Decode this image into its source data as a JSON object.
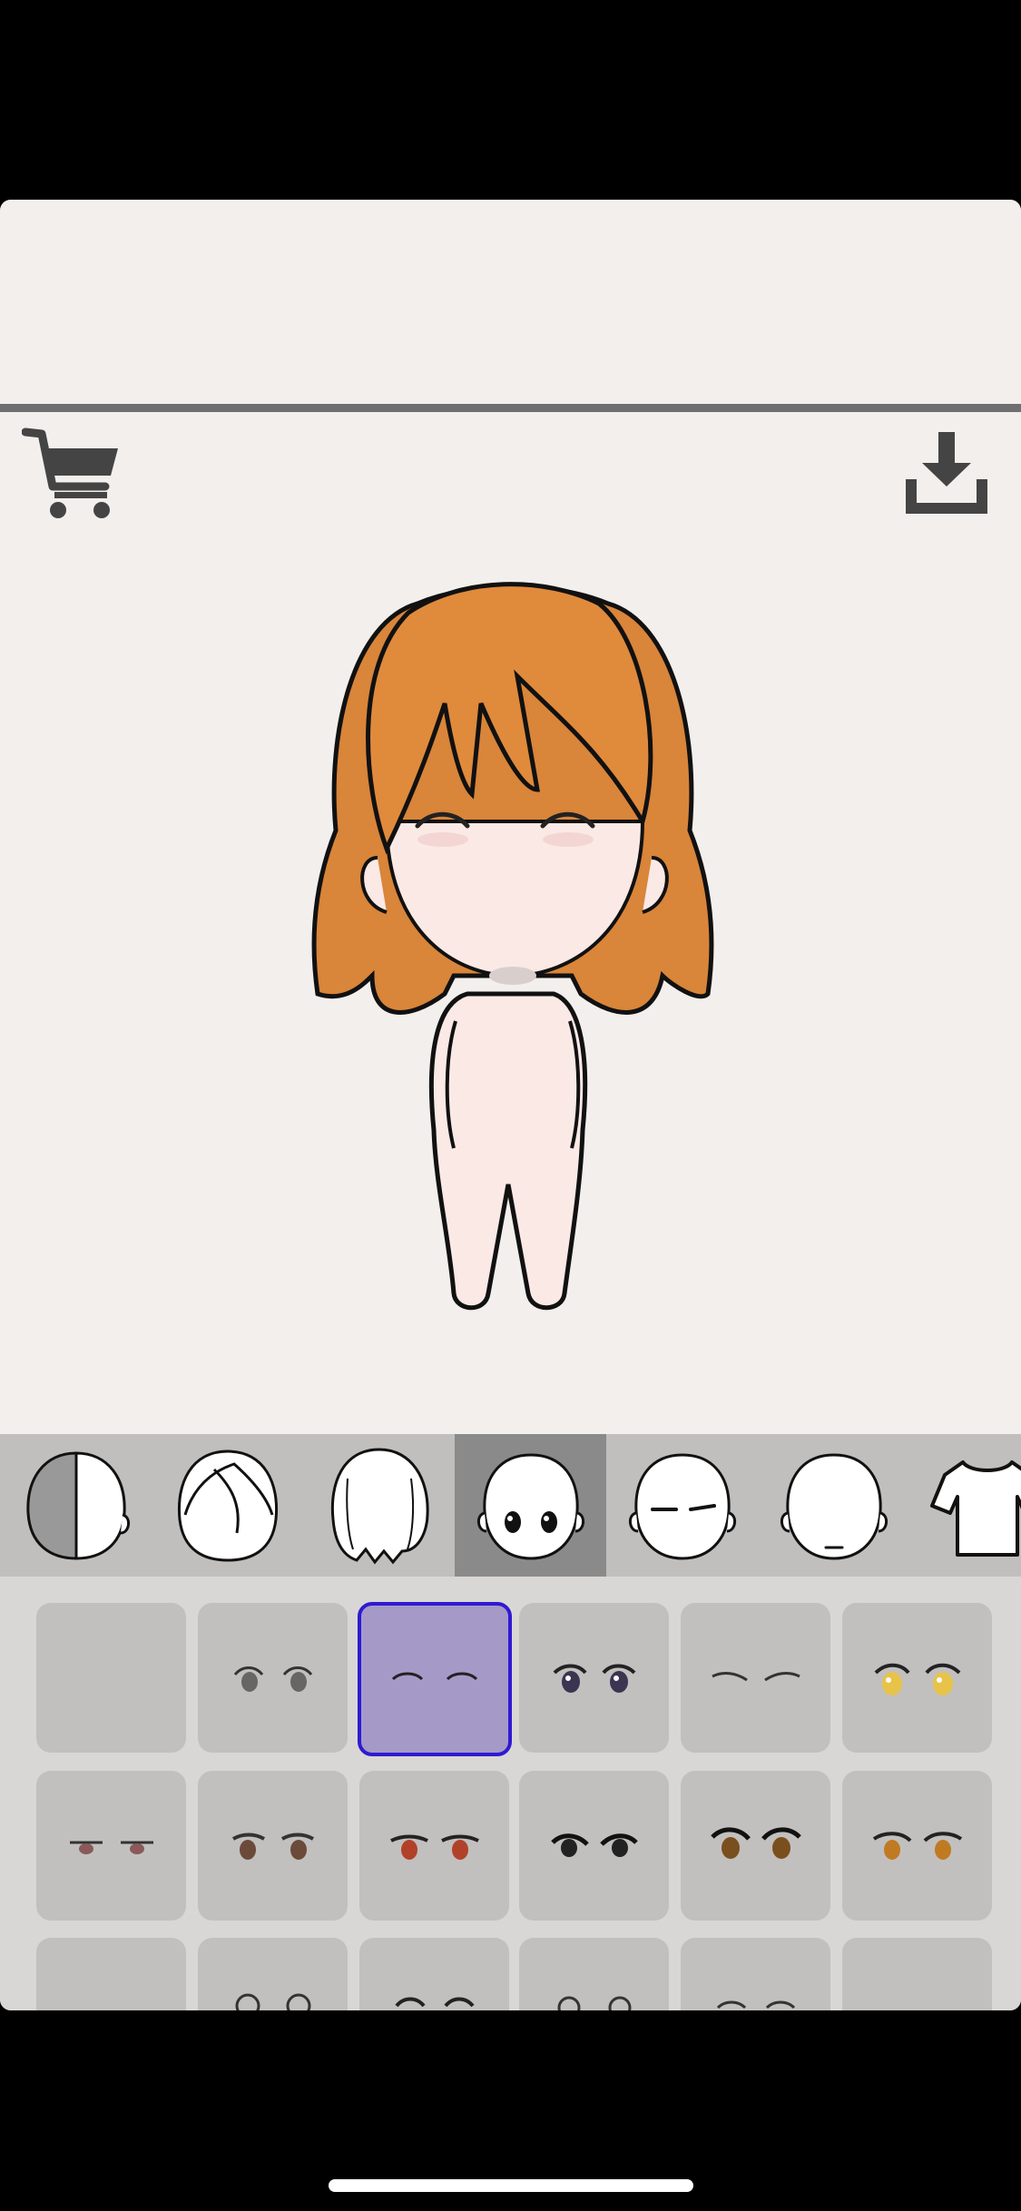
{
  "toolbar": {
    "cart_icon": "cart-icon",
    "download_icon": "download-icon"
  },
  "categories": [
    {
      "id": "skin",
      "icon": "skin-half-head-icon",
      "selected": false
    },
    {
      "id": "back-hair",
      "icon": "back-hair-icon",
      "selected": false
    },
    {
      "id": "front-hair",
      "icon": "front-hair-icon",
      "selected": false
    },
    {
      "id": "eyes",
      "icon": "eyes-head-icon",
      "selected": true
    },
    {
      "id": "eyebrows",
      "icon": "eyebrows-head-icon",
      "selected": false
    },
    {
      "id": "mouth",
      "icon": "mouth-head-icon",
      "selected": false
    },
    {
      "id": "clothes",
      "icon": "shirt-icon",
      "selected": false
    }
  ],
  "eye_options": [
    {
      "style": "none",
      "selected": false
    },
    {
      "style": "round-gray",
      "selected": false
    },
    {
      "style": "closed-happy",
      "selected": true
    },
    {
      "style": "dark-sparkle",
      "selected": false
    },
    {
      "style": "closed-lashes",
      "selected": false
    },
    {
      "style": "yellow-sparkle",
      "selected": false
    },
    {
      "style": "half-lidded-red",
      "selected": false
    },
    {
      "style": "brown-round",
      "selected": false
    },
    {
      "style": "red-sharp",
      "selected": false
    },
    {
      "style": "dark-sharp",
      "selected": false
    },
    {
      "style": "brown-lashes",
      "selected": false
    },
    {
      "style": "amber-lashes",
      "selected": false
    },
    {
      "style": "partial-1",
      "selected": false
    },
    {
      "style": "partial-2",
      "selected": false
    },
    {
      "style": "partial-3",
      "selected": false
    },
    {
      "style": "partial-4",
      "selected": false
    },
    {
      "style": "partial-5",
      "selected": false
    },
    {
      "style": "partial-6",
      "selected": false
    }
  ],
  "colors": {
    "canvas_bg": "#f2efed",
    "category_bar": "#c1bfbd",
    "category_selected": "#8a8a8a",
    "item_cell": "#c2c0be",
    "item_selected_fill": "#a59ac7",
    "item_selected_border": "#2e1ad1",
    "hair": "#e08a3c",
    "skin": "#fbe9e6"
  }
}
